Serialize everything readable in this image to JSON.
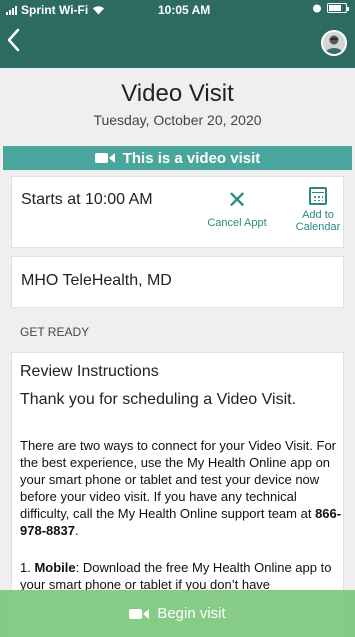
{
  "status_bar": {
    "carrier": "Sprint Wi-Fi",
    "time": "10:05 AM"
  },
  "nav": {
    "back_icon": "chevron-left-icon",
    "avatar_icon": "avatar"
  },
  "header": {
    "title": "Video Visit",
    "date": "Tuesday, October 20, 2020"
  },
  "banner": {
    "label": "This is a video visit",
    "icon": "video-camera-icon"
  },
  "appointment": {
    "time_text": "Starts at 10:00 AM",
    "cancel_label": "Cancel Appt",
    "calendar_label_line1": "Add to",
    "calendar_label_line2": "Calendar"
  },
  "provider": {
    "name": "MHO TeleHealth, MD"
  },
  "section": {
    "label": "GET READY"
  },
  "instructions": {
    "title": "Review Instructions",
    "subtitle": "Thank you for scheduling a Video Visit.",
    "body": "There are two ways to connect for your Video Visit. For the best experience, use the My Health Online app on your smart phone or tablet and test your device now before your video visit. If you have any technical difficulty, call the My Health Online support team at",
    "phone": "866-978-8837",
    "body_end": ".",
    "step1_label": "1. ",
    "step1_bold": "Mobile",
    "step1_text": ": Download the free My Health Online app to your smart phone or tablet if you don’t have"
  },
  "footer": {
    "begin_label": "Begin visit"
  },
  "colors": {
    "nav_bg": "#2d6b62",
    "banner_bg": "#4aa59c",
    "accent": "#2b8a80",
    "begin_bg": "#7dc87d"
  }
}
